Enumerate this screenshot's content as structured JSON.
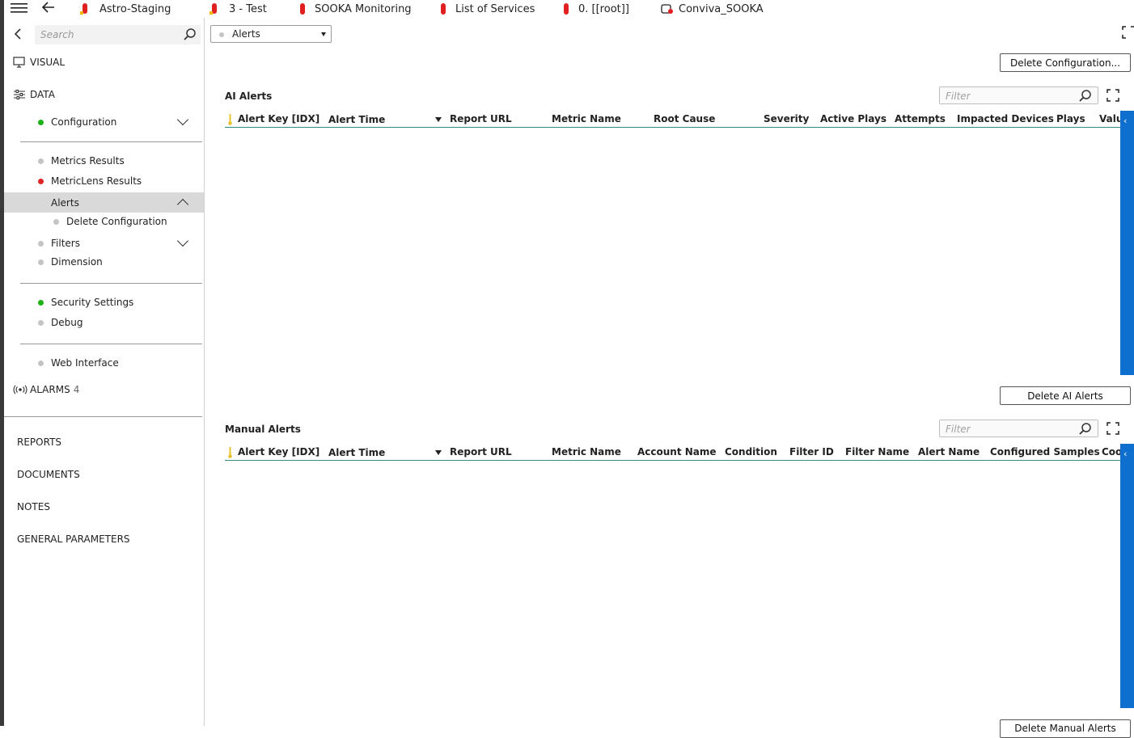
{
  "breadcrumb": [
    {
      "label": "Astro-Staging",
      "icon": "build-icon"
    },
    {
      "label": "3 - Test",
      "icon": "build-icon"
    },
    {
      "label": "SOOKA Monitoring",
      "icon": "status-pill-icon"
    },
    {
      "label": "List of Services",
      "icon": "status-pill-icon"
    },
    {
      "label": "0. [[root]]",
      "icon": "status-pill-icon"
    },
    {
      "label": "Conviva_SOOKA",
      "icon": "element-icon"
    }
  ],
  "sidebar": {
    "search_placeholder": "Search",
    "visual_label": "VISUAL",
    "data_label": "DATA",
    "items": [
      {
        "label": "Configuration",
        "status": "green"
      },
      {
        "label": "Metrics Results",
        "status": "gray"
      },
      {
        "label": "MetricLens Results",
        "status": "red"
      },
      {
        "label": "Alerts",
        "status": "none"
      },
      {
        "label": "Delete Configuration",
        "status": "gray"
      },
      {
        "label": "Filters",
        "status": "gray"
      },
      {
        "label": "Dimension",
        "status": "gray"
      },
      {
        "label": "Security Settings",
        "status": "green"
      },
      {
        "label": "Debug",
        "status": "gray"
      },
      {
        "label": "Web Interface",
        "status": "gray"
      }
    ],
    "alarms_label": "ALARMS",
    "alarms_count": "4",
    "nav": [
      "REPORTS",
      "DOCUMENTS",
      "NOTES",
      "GENERAL PARAMETERS"
    ]
  },
  "main": {
    "page_select": "Alerts",
    "delete_configuration_button": "Delete Configuration...",
    "ai_alerts": {
      "title": "AI Alerts",
      "filter_placeholder": "Filter",
      "columns": [
        "Alert Key [IDX]",
        "Alert Time",
        "Report URL",
        "Metric Name",
        "Root Cause",
        "Severity",
        "Active Plays",
        "Attempts",
        "Impacted Devices",
        "Plays",
        "Value"
      ],
      "rows": [],
      "delete_button": "Delete AI Alerts"
    },
    "manual_alerts": {
      "title": "Manual Alerts",
      "filter_placeholder": "Filter",
      "columns": [
        "Alert Key [IDX]",
        "Alert Time",
        "Report URL",
        "Metric Name",
        "Account Name",
        "Condition",
        "Filter ID",
        "Filter Name",
        "Alert Name",
        "Configured Samples",
        "Cool"
      ],
      "rows": [],
      "delete_button": "Delete Manual Alerts"
    }
  },
  "colors": {
    "accent_blue": "#0f6fce",
    "status_green": "#1db318",
    "status_red": "#e02525",
    "header_line": "#2b8a8a"
  }
}
